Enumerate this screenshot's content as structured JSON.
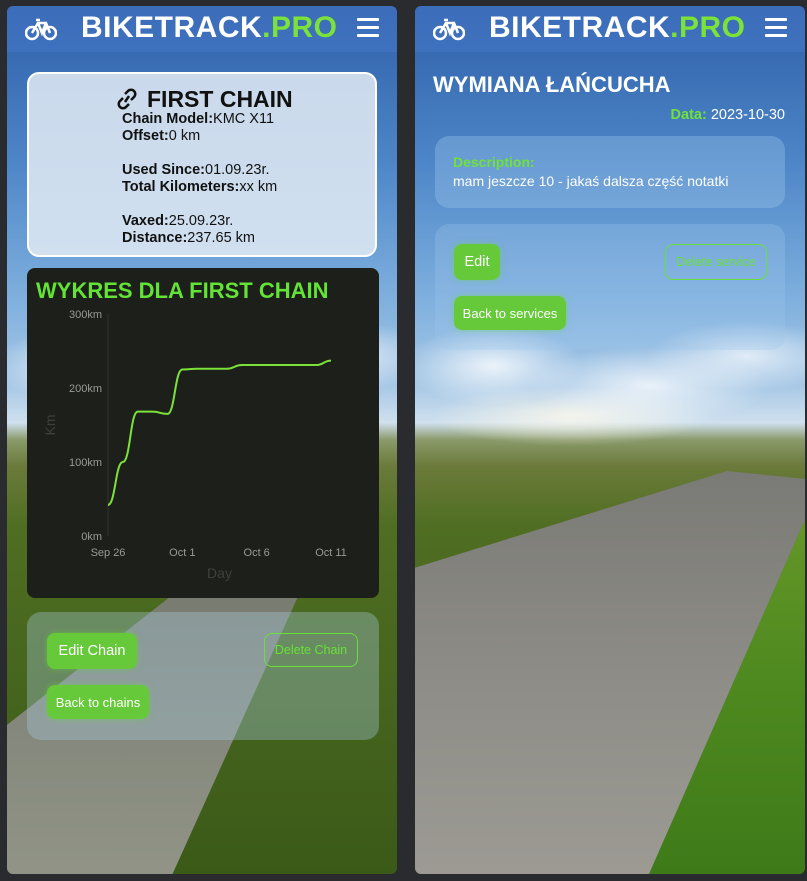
{
  "app": {
    "brand_main": "BIKETRACK",
    "brand_accent": ".PRO",
    "accent_color": "#66c93a",
    "bike_icon": "bike-icon",
    "menu_icon": "hamburger-menu-icon"
  },
  "chain_detail": {
    "title": "FIRST CHAIN",
    "title_icon": "link-icon",
    "fields": [
      {
        "label": "Chain Model:",
        "value": "KMC X11"
      },
      {
        "label": "Offset:",
        "value": "0 km"
      },
      {
        "label": "Used Since:",
        "value": "01.09.23r."
      },
      {
        "label": "Total Kilometers:",
        "value": "xx km"
      },
      {
        "label": "Vaxed:",
        "value": "25.09.23r."
      },
      {
        "label": "Distance:",
        "value": "237.65 km"
      }
    ],
    "edit_label": "Edit Chain",
    "delete_label": "Delete Chain",
    "back_label": "Back to chains"
  },
  "chart_data": {
    "type": "line",
    "title": "WYKRES DLA FIRST CHAIN",
    "xlabel": "Day",
    "ylabel": "Km",
    "x_ticks": [
      "Sep 26",
      "Oct 1",
      "Oct 6",
      "Oct 11"
    ],
    "y_ticks": [
      "0km",
      "100km",
      "200km",
      "300km"
    ],
    "ylim": [
      0,
      300
    ],
    "x": [
      "2023-09-26",
      "2023-09-27",
      "2023-09-28",
      "2023-09-29",
      "2023-09-30",
      "2023-10-01",
      "2023-10-02",
      "2023-10-03",
      "2023-10-04",
      "2023-10-05",
      "2023-10-06",
      "2023-10-07",
      "2023-10-08",
      "2023-10-09",
      "2023-10-10",
      "2023-10-11"
    ],
    "series": [
      {
        "values": [
          42,
          100,
          168,
          168,
          165,
          225,
          226,
          226,
          226,
          231,
          231,
          231,
          231,
          231,
          231,
          237
        ]
      }
    ],
    "line_color": "#7be23a",
    "background": "#1d1f1b"
  },
  "service_detail": {
    "title": "WYMIANA ŁAŃCUCHA",
    "date_label": "Data:",
    "date_value": "2023-10-30",
    "description_label": "Description:",
    "description_text": "mam jeszcze 10 - jakaś dalsza część notatki",
    "edit_label": "Edit",
    "delete_label": "Delete service",
    "back_label": "Back to services"
  }
}
